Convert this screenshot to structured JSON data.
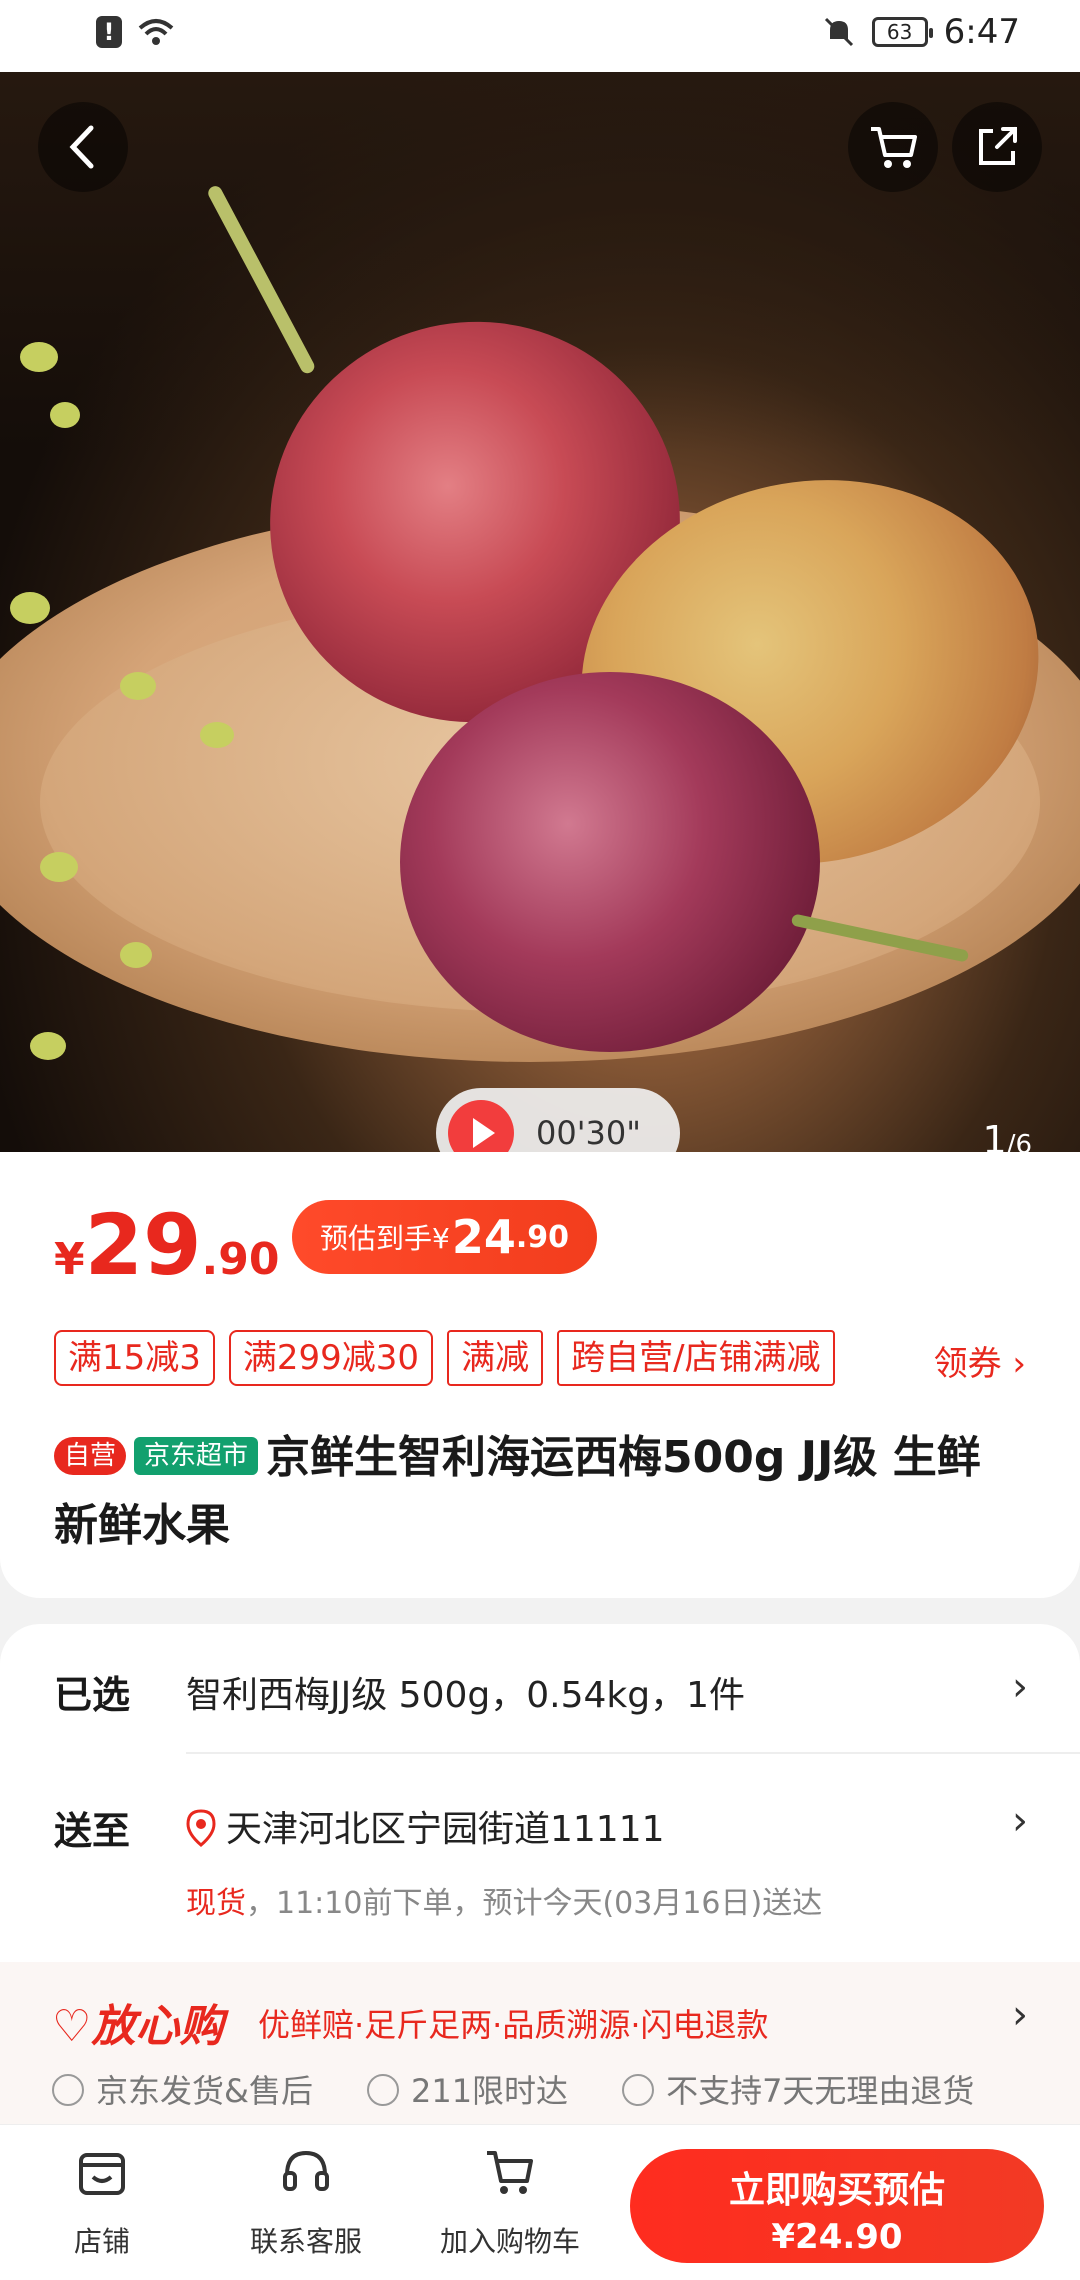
{
  "status_bar": {
    "time": "6:47",
    "battery": "63"
  },
  "hero": {
    "video_duration": "00'30\"",
    "pager_current": "1",
    "pager_total": "/6"
  },
  "product": {
    "price_symbol": "¥",
    "price_int": "29",
    "price_dec": ".90",
    "estimate_label": "预估到手¥",
    "estimate_int": "24",
    "estimate_dec": ".90",
    "coupons": [
      "满15减3",
      "满299减30",
      "满减",
      "跨自营/店铺满减"
    ],
    "get_coupon": "领券 ›",
    "badge_self": "自营",
    "badge_market": "京东超市",
    "title": "京鲜生智利海运西梅500g JJ级 生鲜 新鲜水果"
  },
  "info": {
    "selected_label": "已选",
    "selected_value": "智利西梅JJ级 500g，0.54kg，1件",
    "ship_label": "送至",
    "address": "天津河北区宁园街道11111",
    "stock": "现货",
    "delivery": "，11:10前下单，预计今天(03月16日)送达",
    "assure_brand": "♡放心购",
    "assure_desc": "优鲜赔·足斤足两·品质溯源·闪电退款",
    "assure_items": [
      "京东发货&售后",
      "211限时达",
      "不支持7天无理由退货"
    ]
  },
  "bottom": {
    "store": "店铺",
    "service": "联系客服",
    "cart": "加入购物车",
    "buy_line1": "立即购买预估",
    "buy_line2": "¥24.90"
  },
  "colors": {
    "accent": "#e8281e",
    "green": "#12a06e"
  }
}
